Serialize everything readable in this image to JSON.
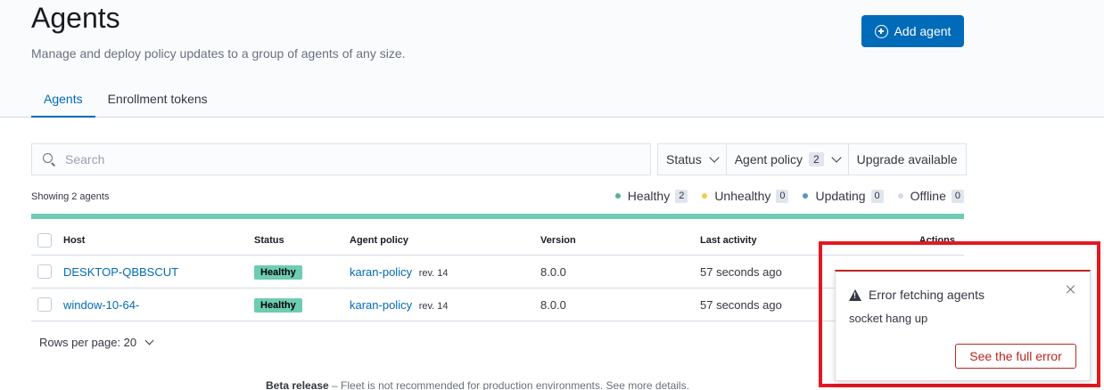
{
  "header": {
    "title": "Agents",
    "subtitle": "Manage and deploy policy updates to a group of agents of any size.",
    "add_agent_label": "Add agent"
  },
  "tabs": [
    {
      "label": "Agents",
      "active": true
    },
    {
      "label": "Enrollment tokens",
      "active": false
    }
  ],
  "search": {
    "placeholder": "Search",
    "value": ""
  },
  "filters": {
    "status_label": "Status",
    "policy_label": "Agent policy",
    "policy_count": "2",
    "upgrade_label": "Upgrade available"
  },
  "summary": {
    "showing": "Showing 2 agents",
    "statuses": [
      {
        "label": "Healthy",
        "count": "2",
        "color": "#54b399"
      },
      {
        "label": "Unhealthy",
        "count": "0",
        "color": "#f5c94a"
      },
      {
        "label": "Updating",
        "count": "0",
        "color": "#6092c0"
      },
      {
        "label": "Offline",
        "count": "0",
        "color": "#d3dae6"
      }
    ],
    "healthy_fraction": 1.0
  },
  "table": {
    "columns": [
      "Host",
      "Status",
      "Agent policy",
      "Version",
      "Last activity",
      "Actions"
    ],
    "rows": [
      {
        "host": "DESKTOP-QBBSCUT",
        "status": "Healthy",
        "policy": "karan-policy",
        "rev": "rev. 14",
        "version": "8.0.0",
        "last_activity": "57 seconds ago"
      },
      {
        "host": "window-10-64-",
        "status": "Healthy",
        "policy": "karan-policy",
        "rev": "rev. 14",
        "version": "8.0.0",
        "last_activity": "57 seconds ago"
      }
    ]
  },
  "pagination": {
    "rows_per_page": "Rows per page: 20"
  },
  "footer": {
    "bold": "Beta release",
    "text": " – Fleet is not recommended for production environments. See more details."
  },
  "toast": {
    "title": "Error fetching agents",
    "message": "socket hang up",
    "button_label": "See the full error"
  },
  "colors": {
    "accent": "#006bb8",
    "healthy": "#6dccb1",
    "danger": "#bd271e",
    "highlight": "#e5171f"
  }
}
